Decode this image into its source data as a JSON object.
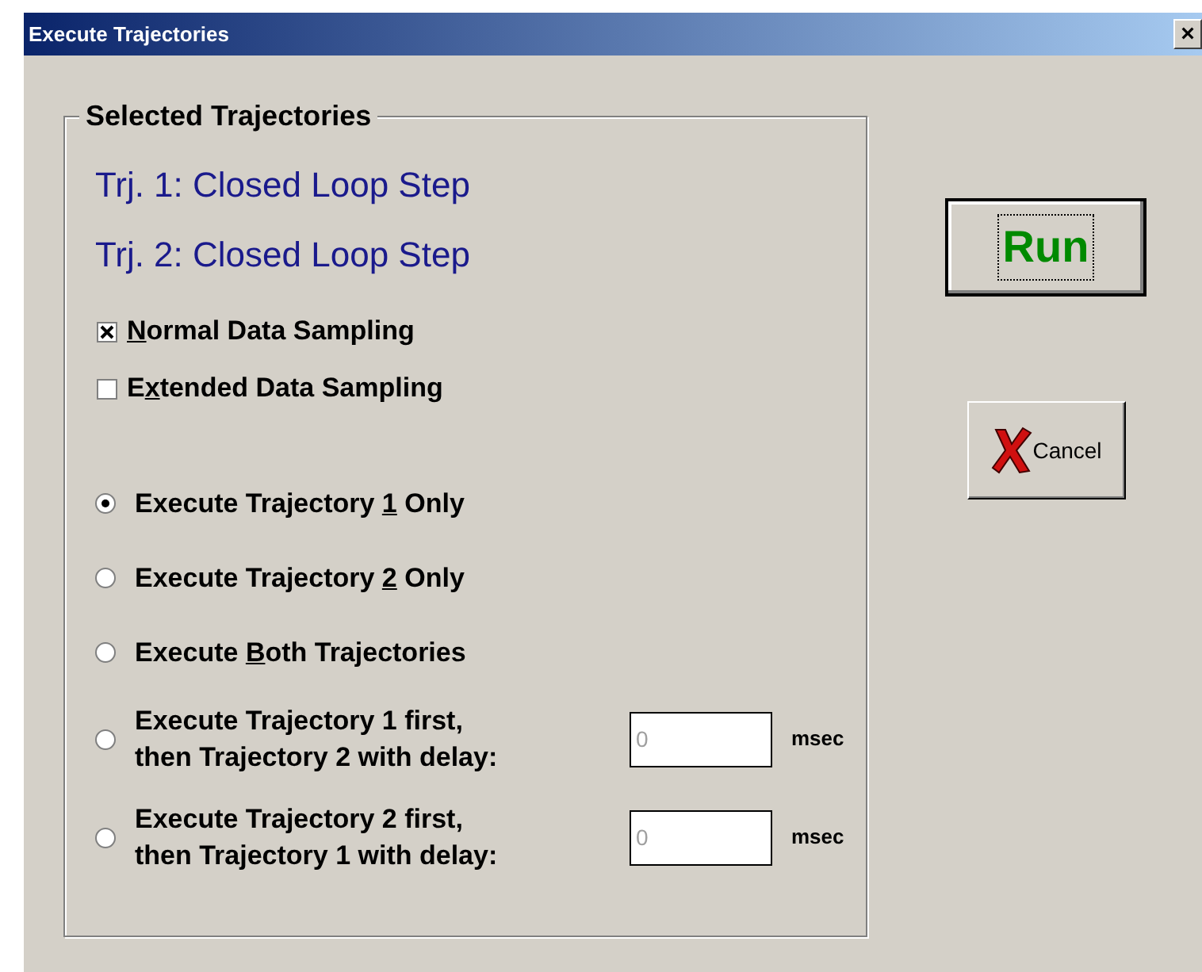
{
  "window": {
    "title": "Execute Trajectories",
    "close": "×"
  },
  "group": {
    "title": "Selected Trajectories",
    "trajectories": [
      "Trj. 1: Closed Loop Step",
      "Trj. 2: Closed Loop Step"
    ],
    "checkboxes": [
      {
        "label_parts": {
          "key": "N",
          "after": "ormal Data Sampling"
        },
        "checked": true
      },
      {
        "label_parts": {
          "before": "E",
          "key": "x",
          "after": "tended Data Sampling"
        },
        "checked": false
      }
    ],
    "options": [
      {
        "kind": "single",
        "label_parts": {
          "before": "Execute Trajectory ",
          "key": "1",
          "after": " Only"
        },
        "selected": true
      },
      {
        "kind": "single",
        "label_parts": {
          "before": "Execute Trajectory ",
          "key": "2",
          "after": " Only"
        },
        "selected": false
      },
      {
        "kind": "single",
        "label_parts": {
          "before": "Execute ",
          "key": "B",
          "after": "oth Trajectories"
        },
        "selected": false
      },
      {
        "kind": "delay",
        "lines": [
          "Execute Trajectory 1 first,",
          "then Trajectory 2 with delay:"
        ],
        "value": "0",
        "disabled": true,
        "unit": "msec",
        "selected": false
      },
      {
        "kind": "delay",
        "lines": [
          "Execute Trajectory 2 first,",
          "then Trajectory 1 with delay:"
        ],
        "value": "0",
        "disabled": true,
        "unit": "msec",
        "selected": false
      }
    ]
  },
  "buttons": {
    "run": "Run",
    "cancel": "Cancel"
  }
}
